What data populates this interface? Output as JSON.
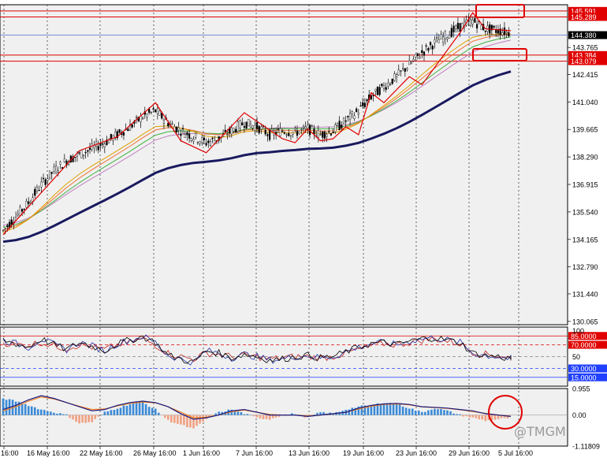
{
  "chart_data": {
    "type": "candlestick",
    "symbol_timeframe": "",
    "main_price_scale": [
      "145.591",
      "145.289",
      "144.380",
      "143.765",
      "143.384",
      "143.079",
      "142.415",
      "141.040",
      "139.665",
      "138.290",
      "136.915",
      "135.540",
      "134.165",
      "132.790",
      "131.440",
      "130.065"
    ],
    "current_price": "144.380",
    "horizontal_levels": [
      {
        "value": 145.591,
        "label": "145.591",
        "color": "#e00000"
      },
      {
        "value": 145.289,
        "label": "145.289",
        "color": "#e00000"
      },
      {
        "value": 143.384,
        "label": "143.384",
        "color": "#e00000"
      },
      {
        "value": 143.079,
        "label": "143.079",
        "color": "#e00000"
      }
    ],
    "x_ticks": [
      "16:00",
      "16 May 16:00",
      "22 May 16:00",
      "26 May 16:00",
      "1 Jun 16:00",
      "7 Jun 16:00",
      "13 Jun 16:00",
      "19 Jun 16:00",
      "23 Jun 16:00",
      "29 Jun 16:00",
      "5 Jul 16:00"
    ],
    "close_path": [
      134.6,
      135.3,
      136.0,
      136.9,
      137.6,
      138.1,
      138.4,
      138.7,
      139.0,
      139.4,
      139.8,
      140.3,
      140.6,
      140.0,
      139.6,
      139.3,
      139.0,
      139.2,
      139.6,
      140.0,
      139.8,
      139.4,
      139.6,
      139.5,
      139.7,
      139.4,
      139.6,
      140.1,
      140.6,
      141.3,
      141.8,
      142.3,
      142.9,
      143.5,
      144.0,
      144.4,
      144.8,
      145.1,
      144.7,
      144.6,
      144.5
    ],
    "ema_ribbon": [
      {
        "color": "#1a1a60",
        "offsets": 0
      },
      {
        "color": "#e0a000",
        "offsets": 1
      },
      {
        "color": "#f07030",
        "offsets": 2
      },
      {
        "color": "#40b040",
        "offsets": 3
      },
      {
        "color": "#c080c0",
        "offsets": 4
      }
    ],
    "zigzag_color": "#e00000",
    "zigzag": [
      [
        0,
        134.4
      ],
      [
        6,
        138.6
      ],
      [
        9,
        139.3
      ],
      [
        12,
        141.0
      ],
      [
        14,
        139.1
      ],
      [
        16,
        138.5
      ],
      [
        19,
        140.5
      ],
      [
        22,
        139.2
      ],
      [
        23,
        139.0
      ],
      [
        24,
        139.7
      ],
      [
        25,
        139.1
      ],
      [
        26,
        139.2
      ],
      [
        27,
        139.8
      ],
      [
        28,
        139.4
      ],
      [
        29,
        141.5
      ],
      [
        30,
        141.0
      ],
      [
        32,
        142.3
      ],
      [
        33,
        141.9
      ],
      [
        36,
        144.5
      ],
      [
        37,
        145.5
      ],
      [
        38,
        144.7
      ],
      [
        40,
        144.6
      ]
    ],
    "oscillator": {
      "scale_top": "100",
      "levels": [
        {
          "value": "85.0000",
          "color": "#e00000"
        },
        {
          "value": "70.0000",
          "color": "#e00000"
        },
        {
          "value": "50",
          "color": "#808080"
        },
        {
          "value": "30.0000",
          "color": "#2040ff"
        },
        {
          "value": "15.0000",
          "color": "#2040ff"
        }
      ],
      "k": [
        78,
        72,
        66,
        80,
        70,
        62,
        74,
        68,
        60,
        72,
        78,
        84,
        74,
        52,
        46,
        40,
        60,
        56,
        48,
        54,
        50,
        44,
        46,
        50,
        52,
        48,
        50,
        58,
        66,
        72,
        74,
        70,
        76,
        80,
        82,
        78,
        74,
        56,
        52,
        50,
        46
      ],
      "d": [
        74,
        70,
        70,
        74,
        68,
        64,
        70,
        66,
        62,
        70,
        74,
        80,
        70,
        56,
        50,
        46,
        56,
        54,
        50,
        52,
        50,
        46,
        48,
        50,
        50,
        48,
        50,
        56,
        62,
        68,
        72,
        70,
        74,
        78,
        80,
        76,
        72,
        58,
        54,
        52,
        48
      ]
    },
    "macd": {
      "scale": [
        "0.955",
        "0.00",
        "-1.11809"
      ],
      "hist": [
        0.6,
        0.5,
        0.35,
        0.2,
        0.1,
        0.0,
        -0.3,
        -0.25,
        0.1,
        0.25,
        0.4,
        0.45,
        0.2,
        -0.2,
        -0.35,
        -0.5,
        -0.15,
        0.1,
        0.2,
        0.05,
        -0.1,
        -0.15,
        0.0,
        0.05,
        -0.1,
        0.1,
        0.05,
        0.2,
        0.3,
        0.35,
        0.45,
        0.4,
        0.25,
        0.1,
        0.25,
        0.15,
        0.0,
        -0.1,
        -0.2,
        -0.15,
        -0.1
      ],
      "signal": [
        0.2,
        0.35,
        0.55,
        0.7,
        0.6,
        0.45,
        0.3,
        0.15,
        0.2,
        0.35,
        0.45,
        0.5,
        0.45,
        0.3,
        0.05,
        -0.15,
        -0.1,
        0.0,
        0.15,
        0.2,
        0.1,
        0.0,
        0.0,
        0.0,
        -0.05,
        0.0,
        0.05,
        0.1,
        0.25,
        0.35,
        0.4,
        0.42,
        0.38,
        0.3,
        0.28,
        0.25,
        0.2,
        0.15,
        0.05,
        0.0,
        -0.05
      ],
      "signal2": [
        0.15,
        0.3,
        0.5,
        0.65,
        0.58,
        0.45,
        0.32,
        0.2,
        0.22,
        0.33,
        0.42,
        0.47,
        0.44,
        0.3,
        0.1,
        -0.1,
        -0.08,
        0.0,
        0.12,
        0.18,
        0.1,
        0.02,
        0.0,
        0.0,
        -0.03,
        0.0,
        0.04,
        0.1,
        0.22,
        0.32,
        0.38,
        0.4,
        0.37,
        0.3,
        0.27,
        0.24,
        0.19,
        0.13,
        0.06,
        0.0,
        -0.04
      ],
      "pos_color": "#3a8ad8",
      "neg_color": "#f0a080",
      "line1_color": "#1a1a80",
      "line2_color": "#f08020"
    },
    "watermark": "@TMGM"
  }
}
